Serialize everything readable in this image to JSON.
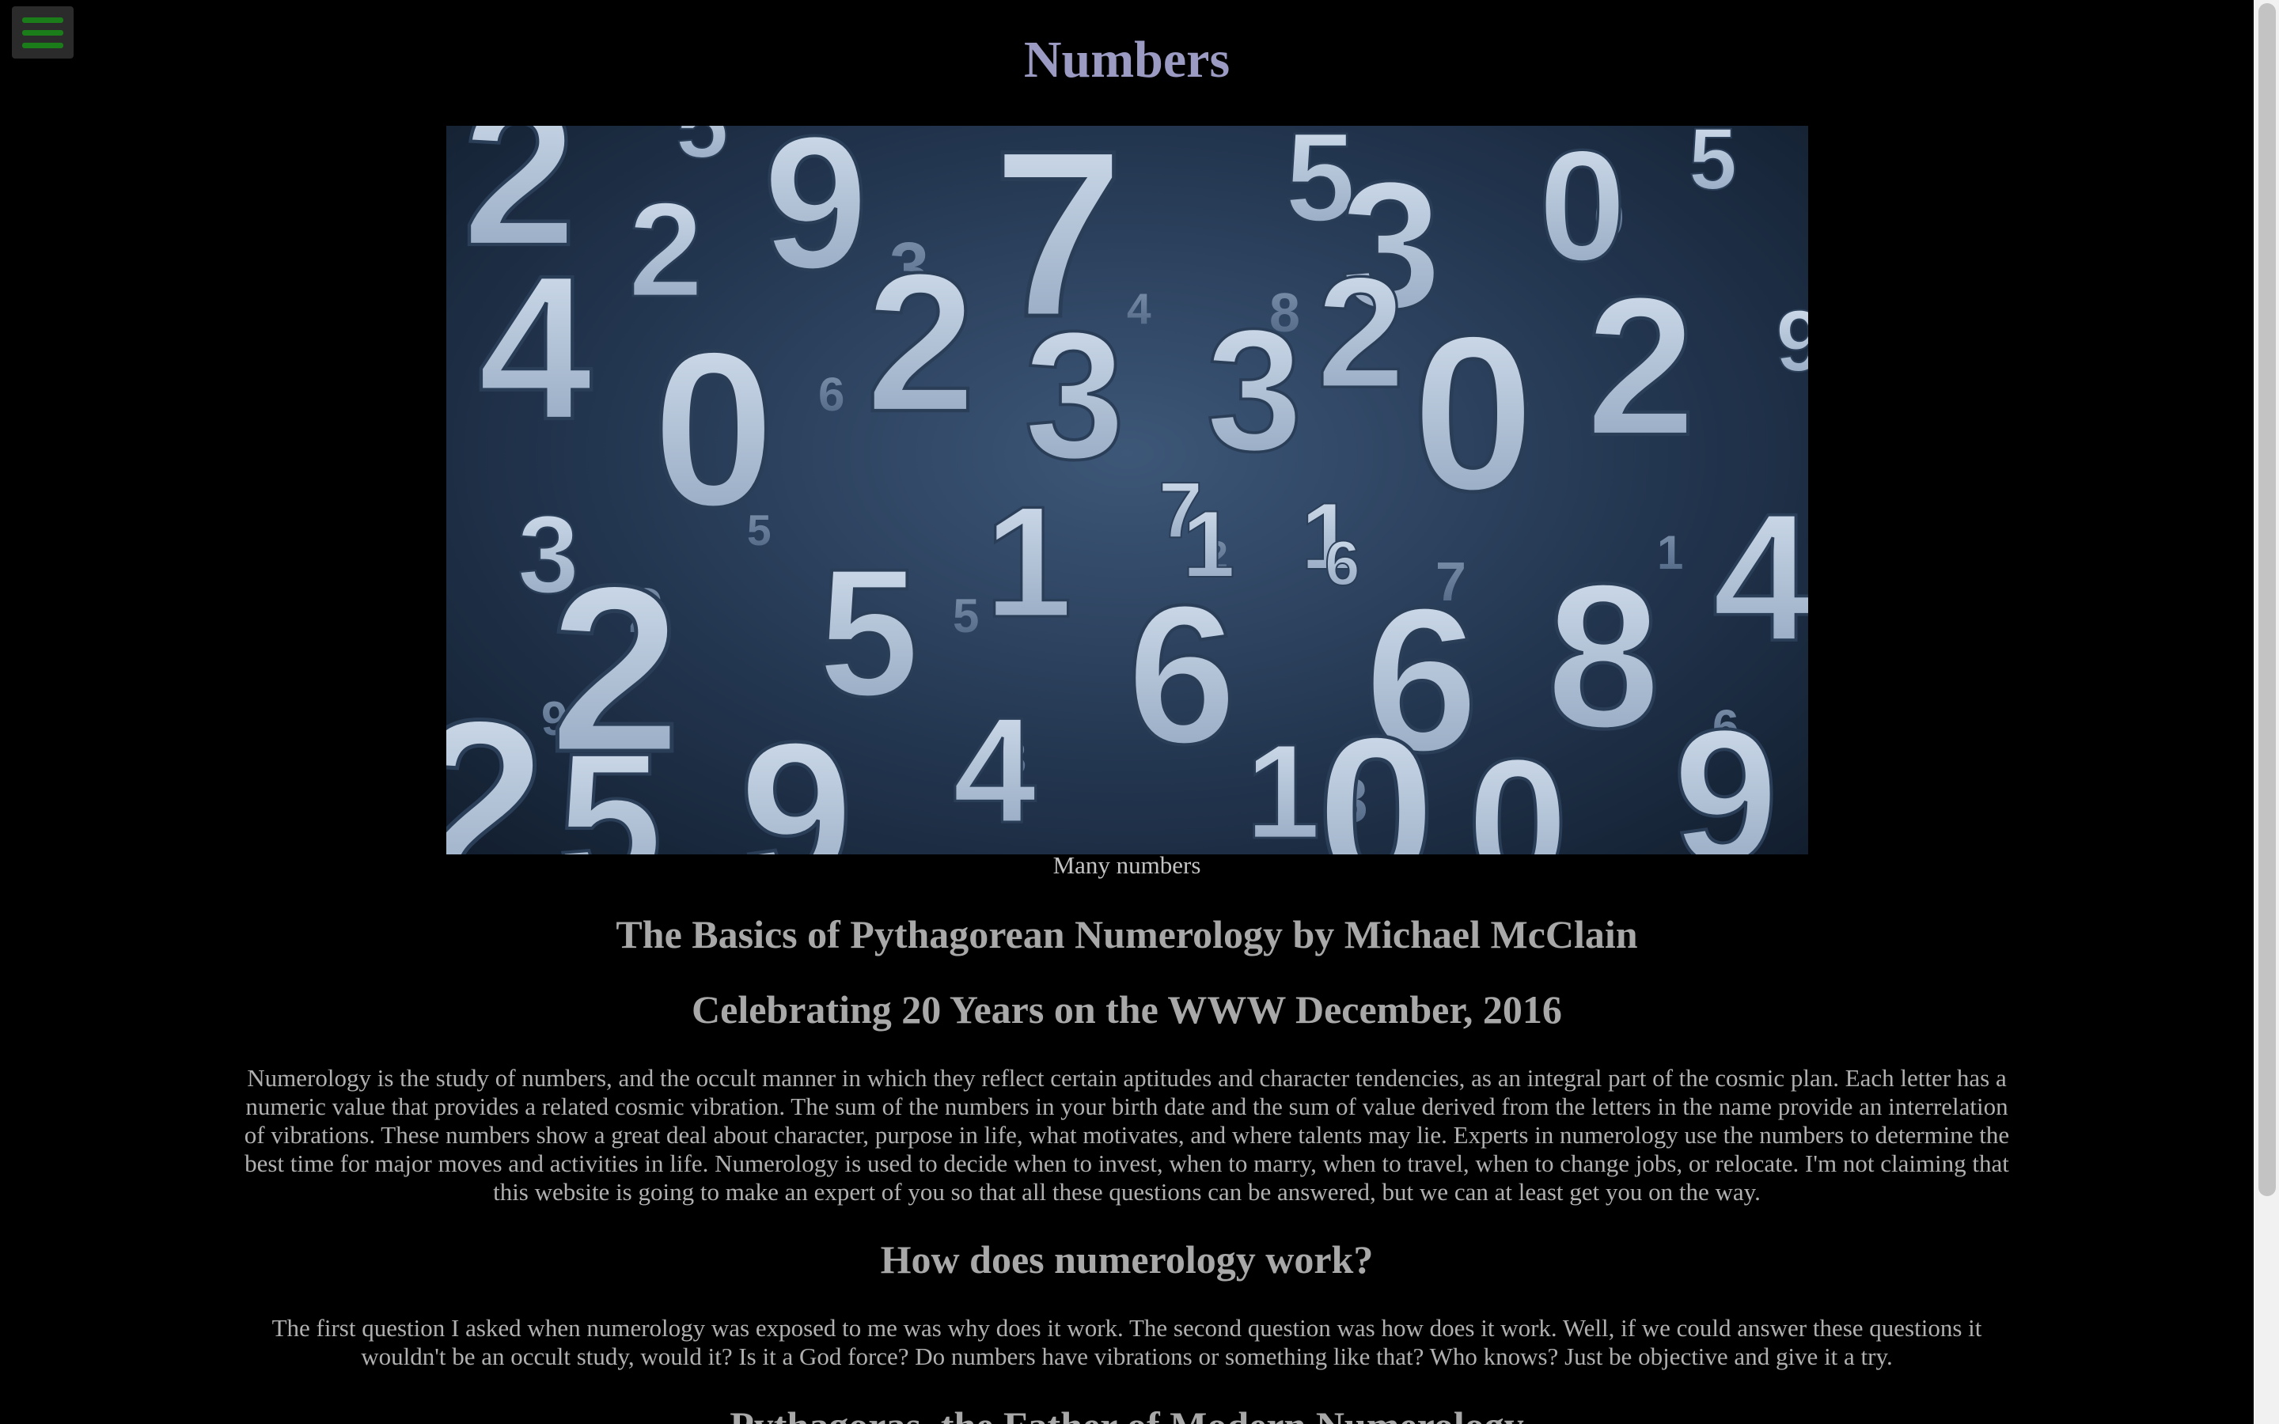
{
  "menu": {
    "icon": "hamburger-menu-icon"
  },
  "page": {
    "title": "Numbers",
    "image_caption": "Many numbers",
    "heading_1": "The Basics of Pythagorean Numerology by Michael McClain",
    "heading_2": "Celebrating 20 Years on the WWW December, 2016",
    "intro_paragraph": "Numerology is the study of numbers, and the occult manner in which they reflect certain aptitudes and character tendencies, as an integral part of the cosmic plan. Each letter has a numeric value that provides a related cosmic vibration. The sum of the numbers in your birth date and the sum of value derived from the letters in the name provide an interrelation of vibrations. These numbers show a great deal about character, purpose in life, what motivates, and where talents may lie. Experts in numerology use the numbers to determine the best time for major moves and activities in life. Numerology is used to decide when to invest, when to marry, when to travel, when to change jobs, or relocate. I'm not claiming that this website is going to make an expert of you so that all these questions can be answered, but we can at least get you on the way.",
    "heading_3": "How does numerology work?",
    "work_paragraph": "The first question I asked when numerology was exposed to me was why does it work. The second question was how does it work. Well, if we could answer these questions it wouldn't be an occult study, would it? Is it a God force? Do numbers have vibrations or something like that? Who knows? Just be objective and give it a try.",
    "heading_4": "Pythagoras, the Father of Modern Numerology"
  },
  "colors": {
    "background": "#000000",
    "title": "#9a9ac2",
    "menu_bars": "#1a7d1a"
  }
}
